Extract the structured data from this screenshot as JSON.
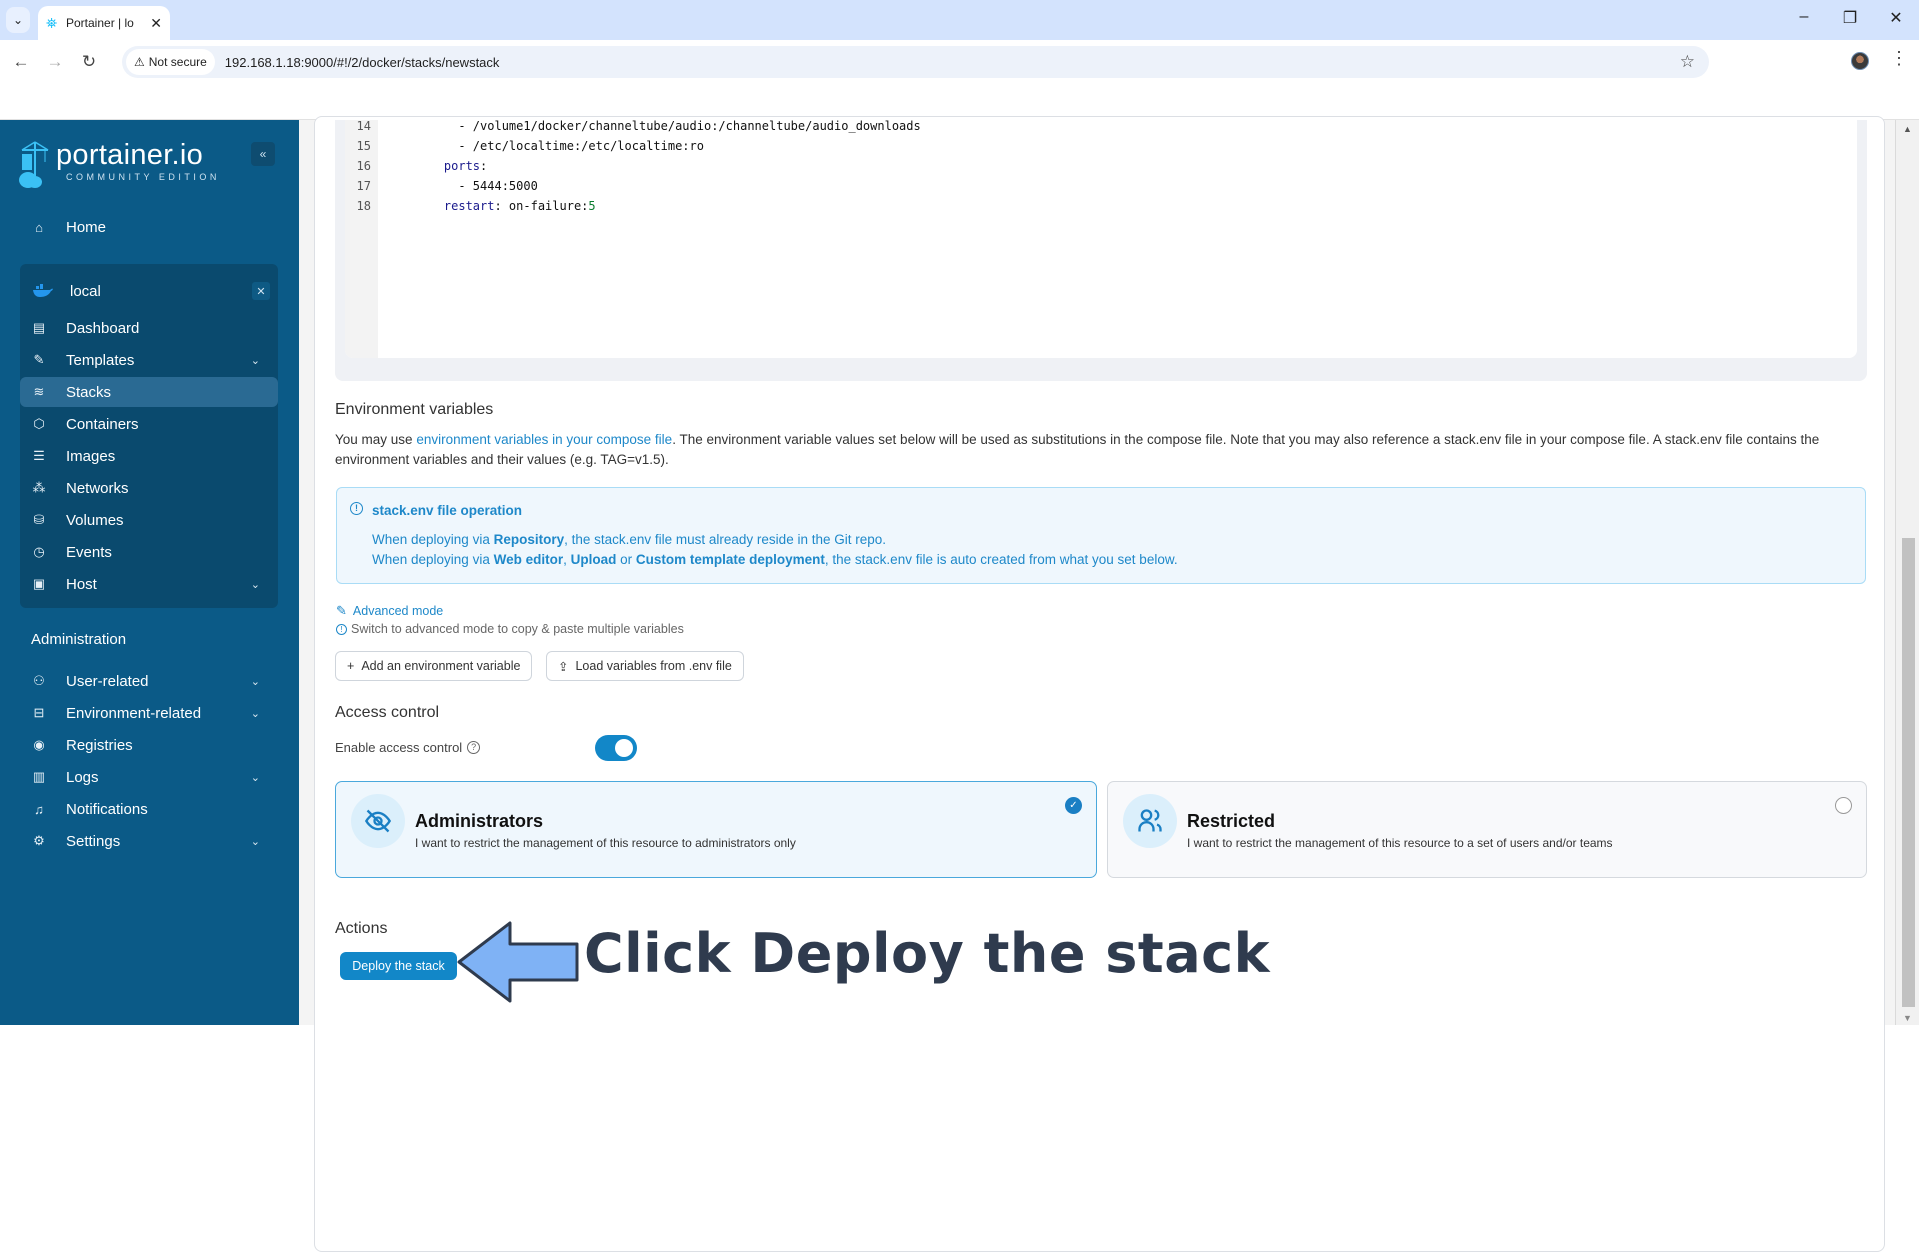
{
  "browser": {
    "tab_title": "Portainer | lo",
    "security_label": "Not secure",
    "url": "192.168.1.18:9000/#!/2/docker/stacks/newstack"
  },
  "sidebar": {
    "logo_text": "portainer.io",
    "logo_sub": "COMMUNITY EDITION",
    "home": "Home",
    "environment": {
      "name": "local",
      "items": [
        {
          "label": "Dashboard",
          "icon": "layout-icon",
          "chevron": false
        },
        {
          "label": "Templates",
          "icon": "edit-icon",
          "chevron": true
        },
        {
          "label": "Stacks",
          "icon": "layers-icon",
          "chevron": false,
          "active": true
        },
        {
          "label": "Containers",
          "icon": "box-icon",
          "chevron": false
        },
        {
          "label": "Images",
          "icon": "list-icon",
          "chevron": false
        },
        {
          "label": "Networks",
          "icon": "network-icon",
          "chevron": false
        },
        {
          "label": "Volumes",
          "icon": "database-icon",
          "chevron": false
        },
        {
          "label": "Events",
          "icon": "clock-icon",
          "chevron": false
        },
        {
          "label": "Host",
          "icon": "server-icon",
          "chevron": true
        }
      ]
    },
    "admin_heading": "Administration",
    "admin_items": [
      {
        "label": "User-related",
        "icon": "users-icon",
        "chevron": true
      },
      {
        "label": "Environment-related",
        "icon": "hard-drive-icon",
        "chevron": true
      },
      {
        "label": "Registries",
        "icon": "radio-icon",
        "chevron": false
      },
      {
        "label": "Logs",
        "icon": "file-text-icon",
        "chevron": true
      },
      {
        "label": "Notifications",
        "icon": "bell-icon",
        "chevron": false
      },
      {
        "label": "Settings",
        "icon": "gear-icon",
        "chevron": true
      }
    ]
  },
  "editor": {
    "lines": [
      {
        "n": "14",
        "text": "      - /volume1/docker/channeltube/audio:/channeltube/audio_downloads"
      },
      {
        "n": "15",
        "text": "      - /etc/localtime:/etc/localtime:ro"
      },
      {
        "n": "16",
        "key": "    ports",
        "text": ":"
      },
      {
        "n": "17",
        "text": "      - 5444:5000"
      },
      {
        "n": "18",
        "key": "    restart",
        "text": ": on-failure:",
        "num": "5"
      }
    ]
  },
  "env_vars": {
    "heading": "Environment variables",
    "desc_pre": "You may use ",
    "desc_link": "environment variables in your compose file",
    "desc_post": ". The environment variable values set below will be used as substitutions in the compose file. Note that you may also reference a stack.env file in your compose file. A stack.env file contains the environment variables and their values (e.g. TAG=v1.5).",
    "info_title": "stack.env file operation",
    "info_line1": {
      "pre": "When deploying via ",
      "b1": "Repository",
      "post": ", the stack.env file must already reside in the Git repo."
    },
    "info_line2": {
      "pre": "When deploying via ",
      "b1": "Web editor",
      "sep1": ", ",
      "b2": "Upload",
      "sep2": " or ",
      "b3": "Custom template deployment",
      "post": ", the stack.env file is auto created from what you set below."
    },
    "advanced_mode": "Advanced mode",
    "advanced_hint": "Switch to advanced mode to copy & paste multiple variables",
    "add_button": "Add an environment variable",
    "load_button": "Load variables from .env file"
  },
  "access_control": {
    "heading": "Access control",
    "enable_label": "Enable access control",
    "enabled": true,
    "options": [
      {
        "title": "Administrators",
        "desc": "I want to restrict the management of this resource to administrators only",
        "selected": true
      },
      {
        "title": "Restricted",
        "desc": "I want to restrict the management of this resource to a set of users and/or teams",
        "selected": false
      }
    ]
  },
  "actions": {
    "heading": "Actions",
    "deploy_button": "Deploy the stack"
  },
  "annotation": {
    "text": "Click Deploy the stack",
    "arrow_color": "#7fb2f5"
  },
  "colors": {
    "sidebar_bg": "#0b5a87",
    "accent": "#1287c8",
    "link": "#1e88c9"
  }
}
